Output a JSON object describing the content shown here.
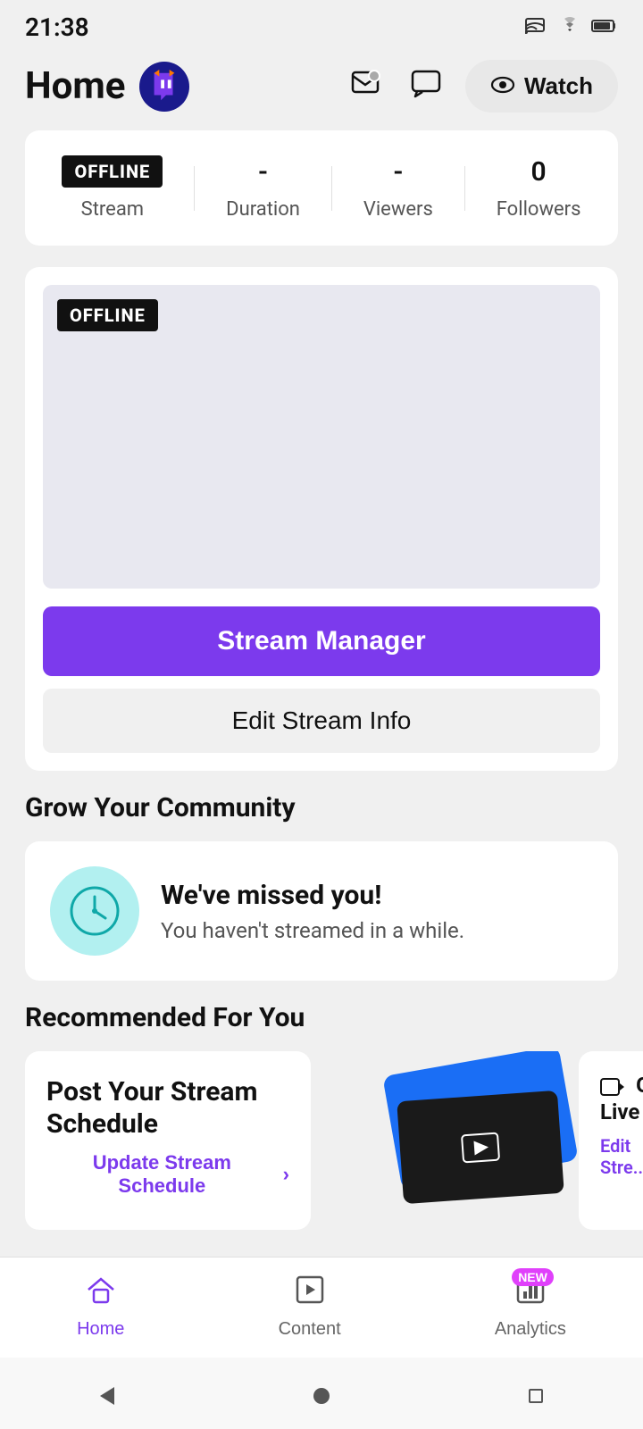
{
  "statusBar": {
    "time": "21:38",
    "icons": [
      "cast",
      "wifi",
      "battery"
    ]
  },
  "header": {
    "title": "Home",
    "logoAlt": "Twitch logo",
    "actions": {
      "inbox": "inbox-icon",
      "chat": "chat-icon",
      "watch": "Watch"
    }
  },
  "stats": {
    "stream": {
      "badge": "OFFLINE",
      "label": "Stream"
    },
    "duration": {
      "value": "-",
      "label": "Duration"
    },
    "viewers": {
      "value": "-",
      "label": "Viewers"
    },
    "followers": {
      "value": "0",
      "label": "Followers"
    }
  },
  "streamPreview": {
    "offlineBadge": "OFFLINE",
    "streamManagerBtn": "Stream Manager",
    "editStreamBtn": "Edit Stream Info"
  },
  "growCommunity": {
    "sectionTitle": "Grow Your Community",
    "card": {
      "heading": "We've missed you!",
      "subtext": "You haven't streamed in a while."
    }
  },
  "recommended": {
    "sectionTitle": "Recommended For You",
    "cards": [
      {
        "title": "Post Your Stream Schedule",
        "linkText": "Update Stream Schedule",
        "linkChevron": "›"
      },
      {
        "title": "Go Live",
        "linkText": "Edit Stre..."
      }
    ]
  },
  "bottomNav": {
    "items": [
      {
        "label": "Home",
        "icon": "home",
        "active": true
      },
      {
        "label": "Content",
        "icon": "content",
        "active": false
      },
      {
        "label": "Analytics",
        "icon": "analytics",
        "active": false,
        "badge": "NEW"
      }
    ]
  },
  "androidNav": {
    "back": "back",
    "home": "home",
    "recents": "recents"
  }
}
